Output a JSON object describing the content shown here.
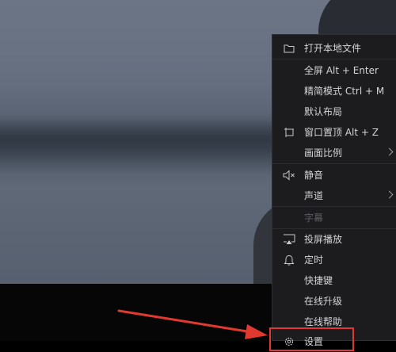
{
  "menu": {
    "items": [
      {
        "label": "打开本地文件",
        "icon": "folder-icon"
      },
      {
        "label": "全屏 Alt + Enter"
      },
      {
        "label": "精简模式 Ctrl + M"
      },
      {
        "label": "默认布局"
      },
      {
        "label": "窗口置顶 Alt + Z",
        "icon": "pin-top-icon"
      },
      {
        "label": "画面比例",
        "submenu": true
      },
      {
        "label": "静音",
        "icon": "mute-speaker-icon"
      },
      {
        "label": "声道",
        "submenu": true
      },
      {
        "label": "字幕",
        "disabled": true
      },
      {
        "label": "投屏播放",
        "icon": "cast-screen-icon"
      },
      {
        "label": "定时",
        "icon": "bell-icon"
      },
      {
        "label": "快捷键"
      },
      {
        "label": "在线升级"
      },
      {
        "label": "在线帮助"
      },
      {
        "label": "设置",
        "icon": "gear-icon"
      }
    ]
  },
  "annotation": {
    "color": "#e03a30"
  }
}
